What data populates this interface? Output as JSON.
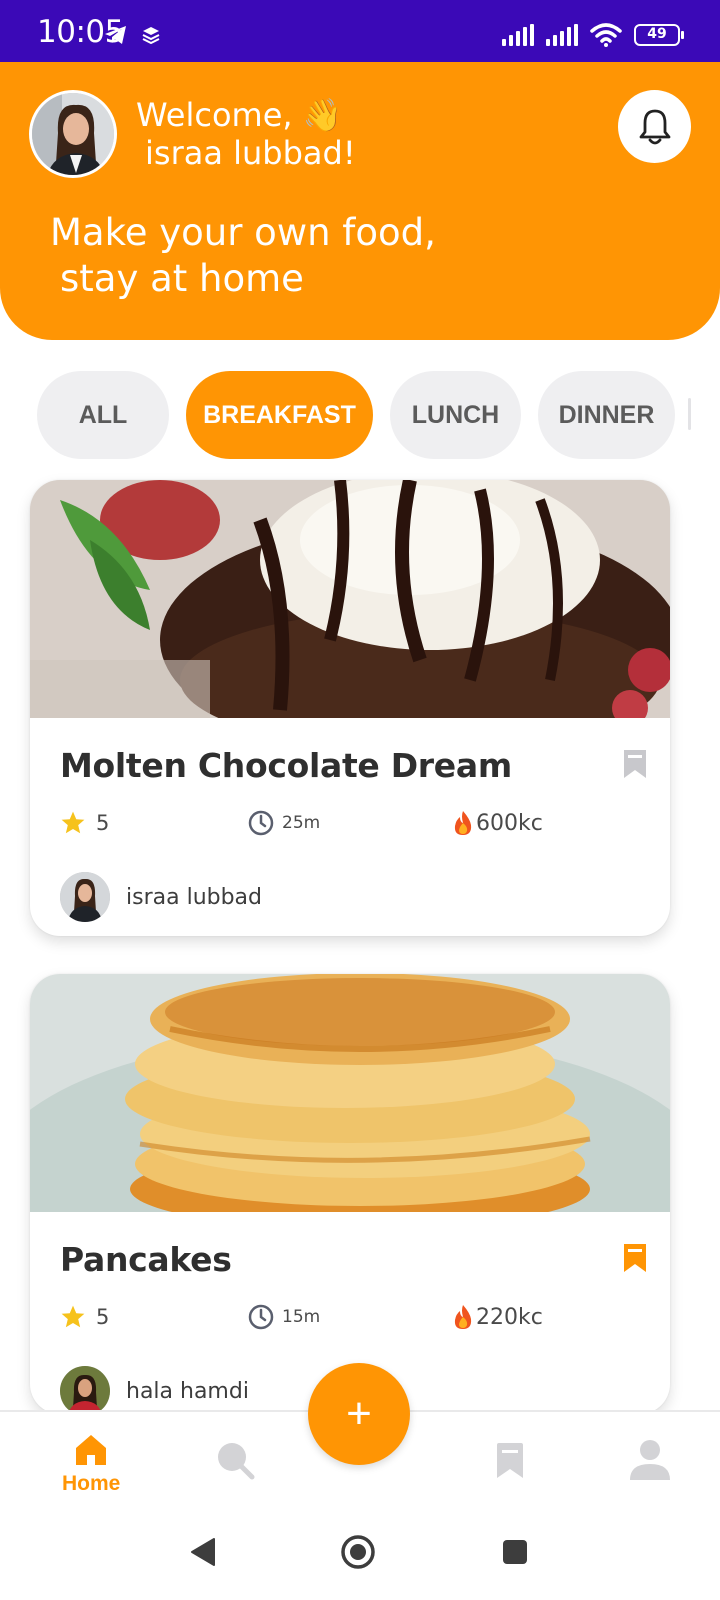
{
  "status_bar": {
    "time": "10:05",
    "battery": "49",
    "background": "#3b09b7"
  },
  "header": {
    "welcome_line": "Welcome, 👋",
    "user_name": "israa lubbad!",
    "tagline_line1": "Make your own food,",
    "tagline_line2": "stay at home",
    "accent": "#ff9504",
    "bell_icon": "bell-icon"
  },
  "categories": {
    "items": [
      "ALL",
      "BREAKFAST",
      "LUNCH",
      "DINNER"
    ],
    "selected": "BREAKFAST"
  },
  "recipes": [
    {
      "title": "Molten Chocolate Dream",
      "rating": "5",
      "time": "25m",
      "calories": "600kc",
      "author": "israa lubbad",
      "saved": false
    },
    {
      "title": "Pancakes",
      "rating": "5",
      "time": "15m",
      "calories": "220kc",
      "author": "hala hamdi",
      "saved": true
    }
  ],
  "bottom_nav": {
    "home_label": "Home",
    "active": "home",
    "add_label": "+"
  }
}
